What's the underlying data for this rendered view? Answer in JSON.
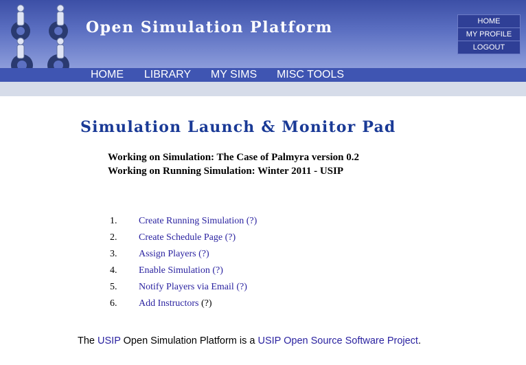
{
  "header": {
    "site_title": "Open Simulation Platform",
    "top_nav": [
      "HOME",
      "MY PROFILE",
      "LOGOUT"
    ],
    "main_nav": [
      {
        "label": "HOME",
        "active": false
      },
      {
        "label": "LIBRARY",
        "active": false
      },
      {
        "label": "MY SIMS",
        "active": true
      },
      {
        "label": "MISC TOOLS",
        "active": false
      }
    ],
    "logo_icon": "gear-people-logo-icon"
  },
  "main": {
    "title": "Simulation Launch & Monitor Pad",
    "simulation_line": "Working on Simulation: The Case of Palmyra version 0.2",
    "running_line": "Working on Running Simulation: Winter 2011 - USIP",
    "steps": [
      {
        "number": "1.",
        "label": "Create Running Simulation",
        "help": "(?)"
      },
      {
        "number": "2.",
        "label": "Create Schedule Page",
        "help": "(?)"
      },
      {
        "number": "3.",
        "label": "Assign Players",
        "help": "(?)"
      },
      {
        "number": "4.",
        "label": "Enable Simulation",
        "help": "(?)"
      },
      {
        "number": "5.",
        "label": "Notify Players via Email",
        "help": "(?)"
      },
      {
        "number": "6.",
        "label": "Add Instructors",
        "help": "(?)"
      }
    ]
  },
  "footer": {
    "prefix": "The",
    "usip_link": "USIP",
    "middle": "Open Simulation Platform is a",
    "project_link": "USIP Open Source Software Project",
    "suffix": "."
  },
  "colors": {
    "header_dark": "#3c4fa6",
    "nav_bar": "#3f55b2",
    "nav_active": "#a5b3e8",
    "subbar": "#d6dce9",
    "title": "#1a3a96",
    "link": "#2a22a0"
  }
}
